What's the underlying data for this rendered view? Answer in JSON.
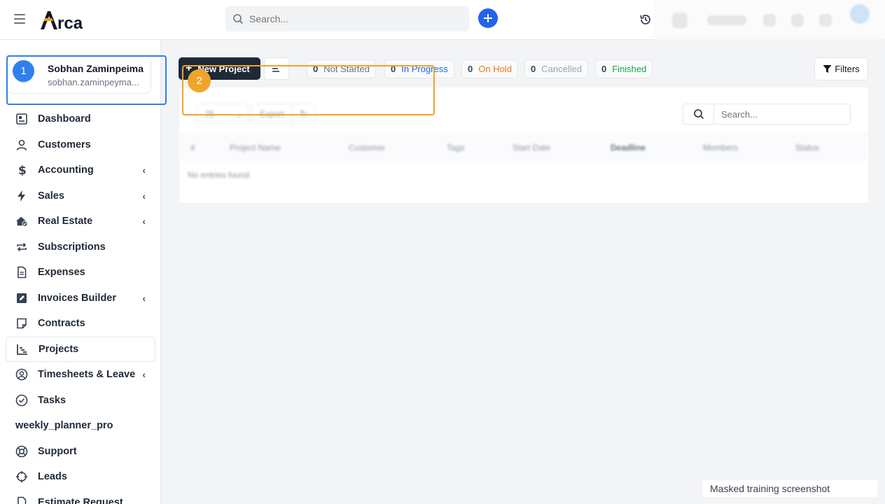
{
  "header": {
    "logo_text": "Arca",
    "search_placeholder": "Search..."
  },
  "sidebar": {
    "profile": {
      "name": "Sobhan Zaminpeima",
      "email": "sobhan.zaminpeyma..."
    },
    "items": [
      {
        "label": "Dashboard",
        "icon": "dashboard-icon",
        "chevron": false
      },
      {
        "label": "Customers",
        "icon": "user-icon",
        "chevron": false
      },
      {
        "label": "Accounting",
        "icon": "dollar-icon",
        "chevron": true
      },
      {
        "label": "Sales",
        "icon": "bolt-icon",
        "chevron": true
      },
      {
        "label": "Real Estate",
        "icon": "house-icon",
        "chevron": true
      },
      {
        "label": "Subscriptions",
        "icon": "repeat-icon",
        "chevron": false
      },
      {
        "label": "Expenses",
        "icon": "file-icon",
        "chevron": false
      },
      {
        "label": "Invoices Builder",
        "icon": "edit-icon",
        "chevron": true
      },
      {
        "label": "Contracts",
        "icon": "note-icon",
        "chevron": false
      },
      {
        "label": "Projects",
        "icon": "chart-icon",
        "chevron": false,
        "active": true
      },
      {
        "label": "Timesheets & Leave",
        "icon": "user-circle-icon",
        "chevron": true
      },
      {
        "label": "Tasks",
        "icon": "check-circle-icon",
        "chevron": false
      },
      {
        "label": "weekly_planner_pro",
        "icon": "",
        "chevron": false
      },
      {
        "label": "Support",
        "icon": "lifebuoy-icon",
        "chevron": false
      },
      {
        "label": "Leads",
        "icon": "crosshair-icon",
        "chevron": false
      },
      {
        "label": "Estimate Request",
        "icon": "file-icon",
        "chevron": false
      }
    ]
  },
  "toolbar": {
    "new_project_label": "New Project",
    "filters_label": "Filters",
    "statuses": [
      {
        "count": "0",
        "label": "Not Started",
        "color": "#6b7280"
      },
      {
        "count": "0",
        "label": "In Progress",
        "color": "#2563eb"
      },
      {
        "count": "0",
        "label": "On Hold",
        "color": "#ea7c1a"
      },
      {
        "count": "0",
        "label": "Cancelled",
        "color": "#9ca3af"
      },
      {
        "count": "0",
        "label": "Finished",
        "color": "#16a34a"
      }
    ]
  },
  "table": {
    "page_size": "25",
    "export_label": "Export",
    "search_placeholder": "Search...",
    "columns": [
      "#",
      "Project Name",
      "Customer",
      "Tags",
      "Start Date",
      "Deadline",
      "Members",
      "Status"
    ],
    "empty_text": "No entries found"
  },
  "annotations": {
    "badge_1": "1",
    "badge_2": "2"
  },
  "watermark": "Masked training screenshot"
}
